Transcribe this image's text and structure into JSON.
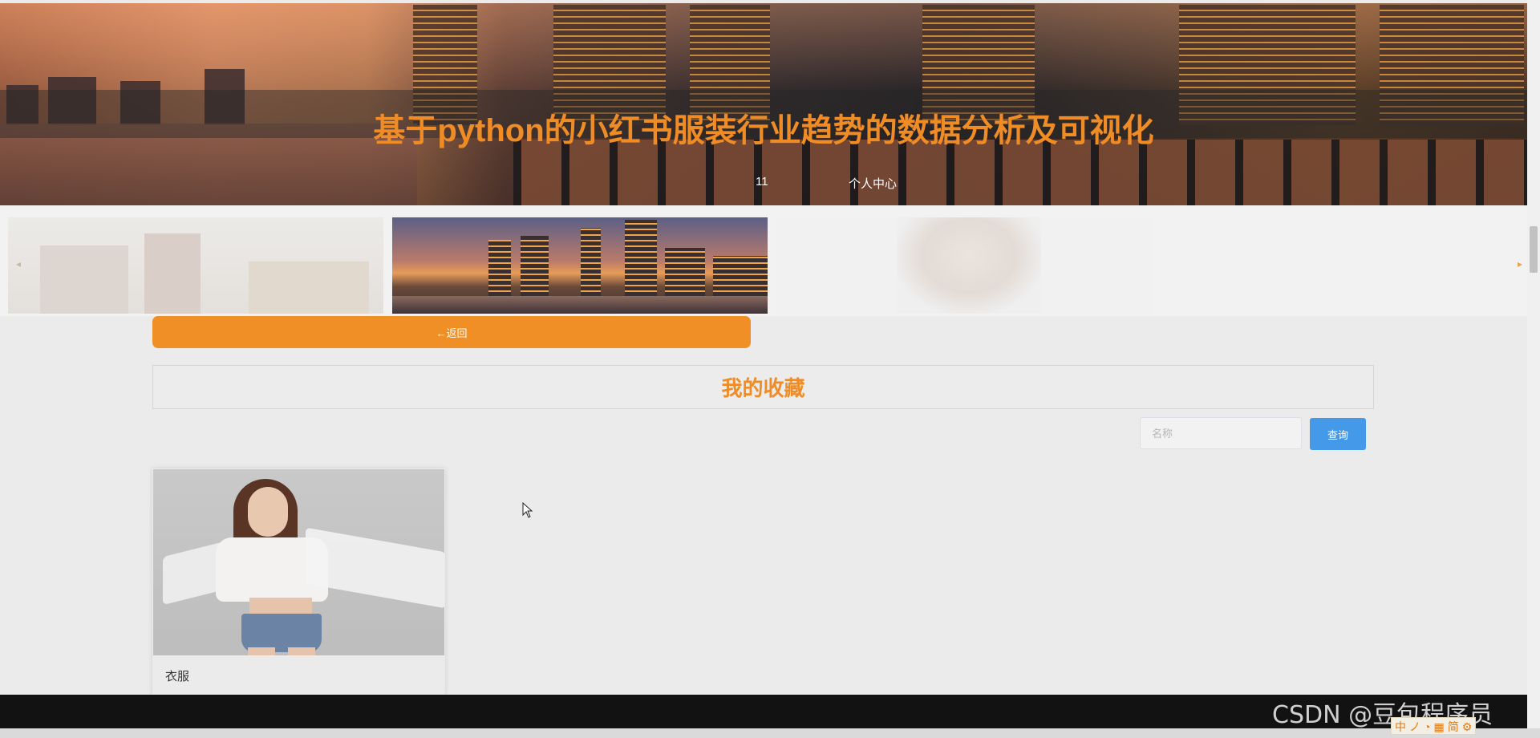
{
  "header": {
    "title": "基于python的小红书服装行业趋势的数据分析及可视化",
    "nav": [
      {
        "label": "11"
      },
      {
        "label": "个人中心"
      }
    ]
  },
  "carousel": {
    "prev_icon": "caret-left-icon",
    "next_icon": "caret-right-icon",
    "prev_glyph": "◂",
    "next_glyph": "▸"
  },
  "back_button": {
    "label": "←返回"
  },
  "section": {
    "title": "我的收藏"
  },
  "search": {
    "placeholder": "名称",
    "value": "",
    "button_label": "查询"
  },
  "favorites": [
    {
      "name": "衣服"
    }
  ],
  "watermark": "CSDN @豆包程序员",
  "ime": [
    "中",
    "ノ",
    "◔",
    "▦",
    "简",
    "⚙"
  ],
  "colors": {
    "accent": "#ef8c26",
    "primary_button": "#4499e9",
    "back_button": "#ef8f25"
  }
}
